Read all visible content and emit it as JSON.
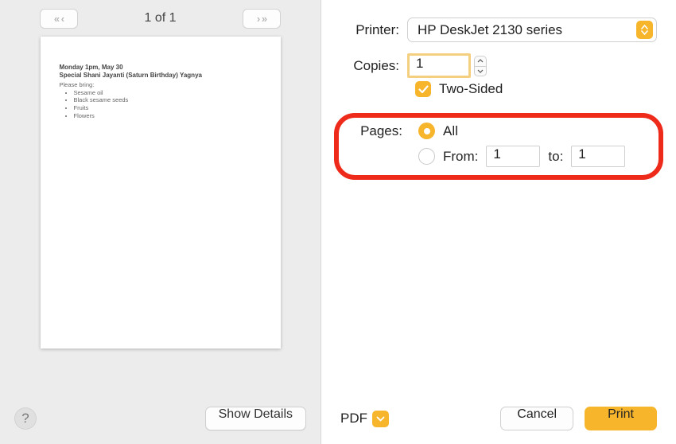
{
  "preview": {
    "page_counter": "1 of 1",
    "nav_prev_glyph": "«  ‹",
    "nav_next_glyph": "›  »",
    "document": {
      "line1": "Monday 1pm, May 30",
      "line2": "Special Shani Jayanti (Saturn Birthday) Yagnya",
      "line3": "Please bring:",
      "items": [
        "Sesame oil",
        "Black sesame seeds",
        "Fruits",
        "Flowers"
      ]
    },
    "help_glyph": "?",
    "show_details_label": "Show Details"
  },
  "settings": {
    "printer_label": "Printer:",
    "printer_value": "HP DeskJet 2130 series",
    "copies_label": "Copies:",
    "copies_value": "1",
    "two_sided_label": "Two-Sided",
    "two_sided_checked": true,
    "pages_label": "Pages:",
    "pages_all_label": "All",
    "pages_from_label": "From:",
    "pages_to_label": "to:",
    "pages_from_value": "1",
    "pages_to_value": "1",
    "pages_all_selected": true
  },
  "footer": {
    "pdf_label": "PDF",
    "cancel_label": "Cancel",
    "print_label": "Print"
  },
  "colors": {
    "accent": "#f7b52c",
    "highlight_ring": "#ee2a1b"
  }
}
